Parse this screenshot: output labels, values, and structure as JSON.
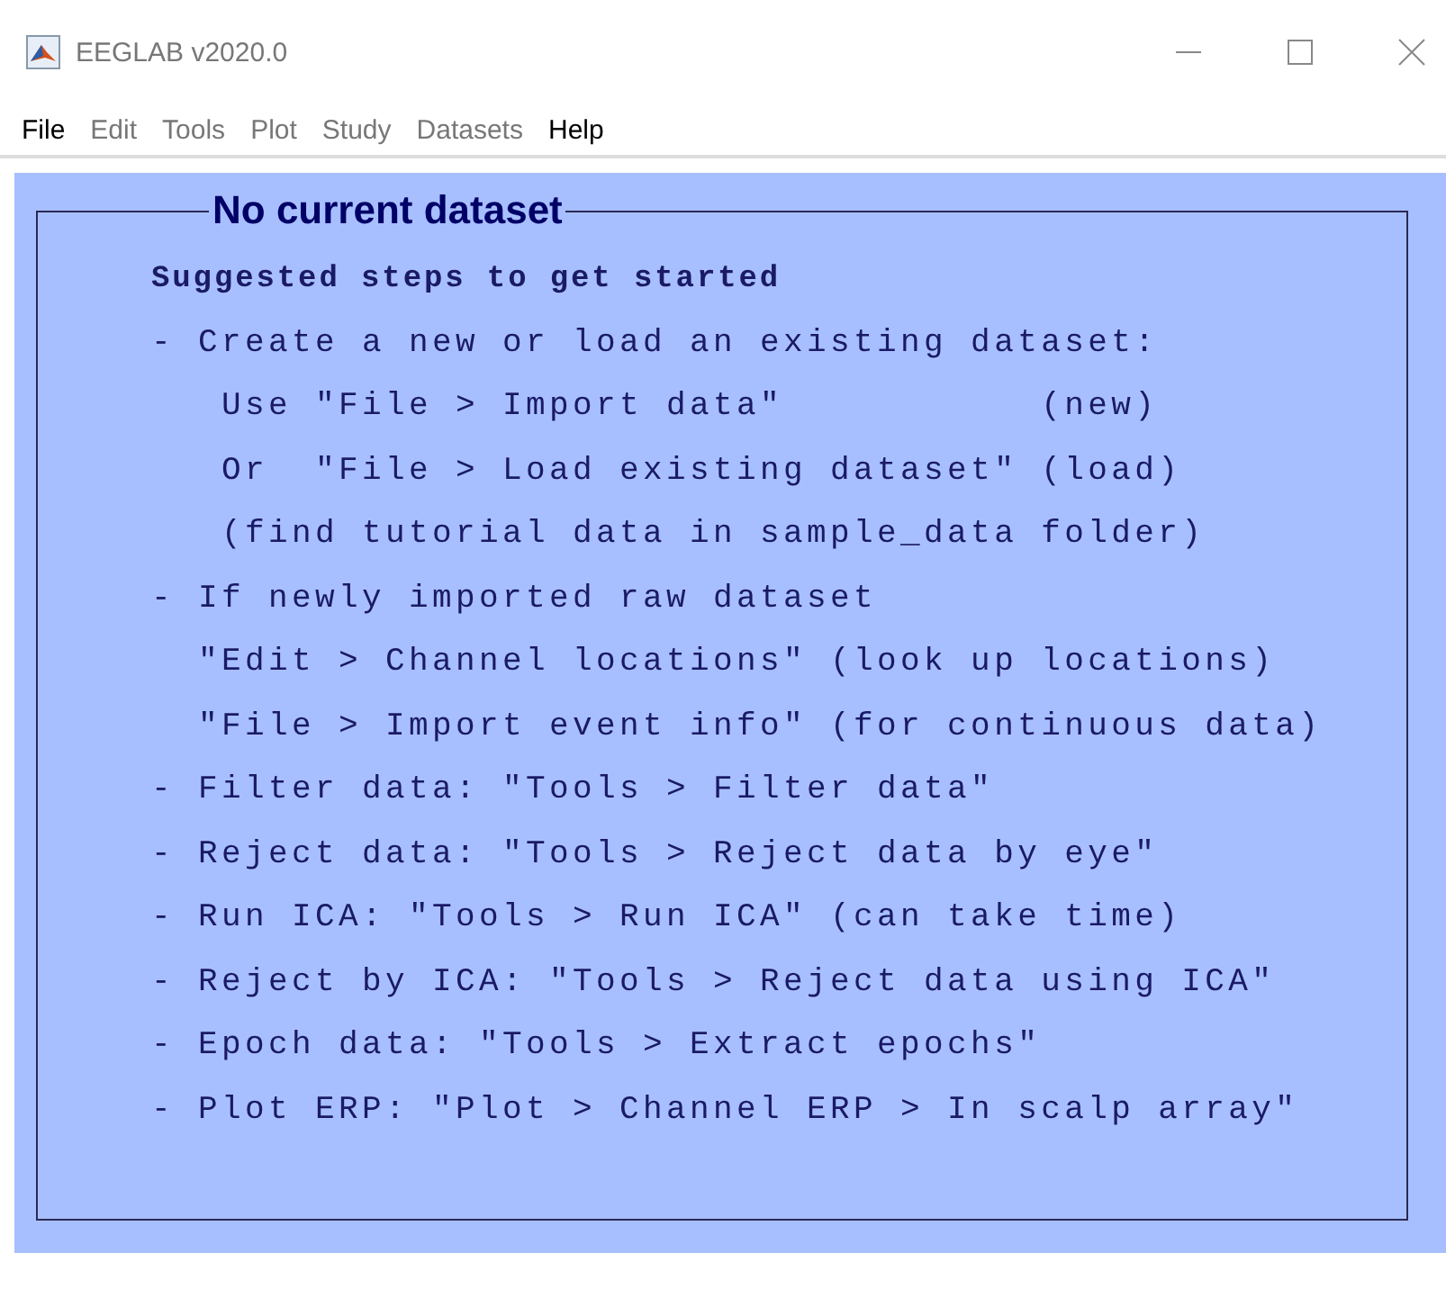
{
  "window": {
    "title": "EEGLAB v2020.0"
  },
  "menu": [
    {
      "label": "File",
      "disabled": false
    },
    {
      "label": "Edit",
      "disabled": true
    },
    {
      "label": "Tools",
      "disabled": true
    },
    {
      "label": "Plot",
      "disabled": true
    },
    {
      "label": "Study",
      "disabled": true
    },
    {
      "label": "Datasets",
      "disabled": true
    },
    {
      "label": "Help",
      "disabled": false
    }
  ],
  "panel": {
    "title": "No current dataset",
    "heading": "Suggested steps to get started",
    "lines": [
      "- Create a new or load an existing dataset:",
      "   Use \"File > Import data\"           (new)",
      "   Or  \"File > Load existing dataset\" (load)",
      "   (find tutorial data in sample_data folder)",
      "- If newly imported raw dataset",
      "  \"Edit > Channel locations\" (look up locations)",
      "  \"File > Import event info\" (for continuous data)",
      "- Filter data: \"Tools > Filter data\"",
      "- Reject data: \"Tools > Reject data by eye\"",
      "- Run ICA: \"Tools > Run ICA\" (can take time)",
      "- Reject by ICA: \"Tools > Reject data using ICA\"",
      "- Epoch data: \"Tools > Extract epochs\"",
      "- Plot ERP: \"Plot > Channel ERP > In scalp array\""
    ]
  }
}
